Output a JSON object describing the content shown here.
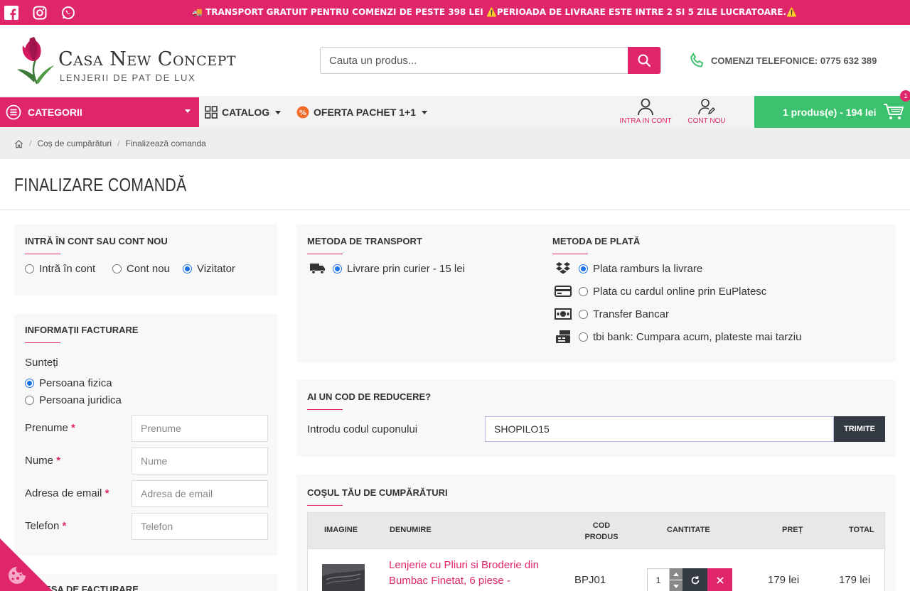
{
  "colors": {
    "brand": "#e0266b",
    "cart_green": "#3cc26e",
    "dark_button": "#333a44",
    "radio_selected": "#1a73e8"
  },
  "topbar": {
    "social_icons": [
      "facebook-icon",
      "instagram-icon",
      "whatsapp-icon"
    ],
    "promo": "🚚 TRANSPORT GRATUIT PENTRU COMENZI DE PESTE 398 LEI ⚠️PERIOADA DE LIVRARE ESTE INTRE 2 SI 5 ZILE LUCRATOARE.⚠️"
  },
  "header": {
    "brand": "Casa New Concept",
    "tagline": "LENJERII DE PAT DE LUX",
    "search_placeholder": "Cauta un produs...",
    "phone": "COMENZI TELEFONICE: 0775 632 389"
  },
  "nav": {
    "categories": "CATEGORII",
    "catalog": "CATALOG",
    "offer": "OFERTA PACHET 1+1",
    "login": "INTRA IN CONT",
    "register": "CONT NOU",
    "cart": "1 produs(e) - 194 lei",
    "cart_badge": "1"
  },
  "breadcrumb": [
    "Coș de cumpărături",
    "Finalizează comanda"
  ],
  "page_title": "FINALIZARE COMANDĂ",
  "account": {
    "title": "INTRĂ ÎN CONT SAU CONT NOU",
    "options": [
      "Intră în cont",
      "Cont nou",
      "Vizitator"
    ],
    "selected": "Vizitator"
  },
  "billing": {
    "title": "INFORMAȚII FACTURARE",
    "type_label": "Sunteți",
    "types": [
      "Persoana fizica",
      "Persoana juridica"
    ],
    "selected_type": "Persoana fizica",
    "fields": [
      {
        "label": "Prenume",
        "placeholder": "Prenume"
      },
      {
        "label": "Nume",
        "placeholder": "Nume"
      },
      {
        "label": "Adresa de email",
        "placeholder": "Adresa de email"
      },
      {
        "label": "Telefon",
        "placeholder": "Telefon"
      }
    ],
    "required_mark": "*",
    "next_section": "ADRESA DE FACTURARE"
  },
  "transport": {
    "title": "METODA DE TRANSPORT",
    "option": "Livrare prin curier - 15 lei"
  },
  "payment": {
    "title": "METODA DE PLATĂ",
    "options": [
      {
        "label": "Plata ramburs la livrare",
        "icon": "dropbox-icon"
      },
      {
        "label": "Plata cu cardul online prin EuPlatesc",
        "icon": "credit-card-icon"
      },
      {
        "label": "Transfer Bancar",
        "icon": "money-bill-icon"
      },
      {
        "label": "tbi bank: Cumpara acum, plateste mai tarziu",
        "icon": "cash-register-icon"
      }
    ],
    "selected": "Plata ramburs la livrare"
  },
  "coupon": {
    "title": "AI UN COD DE REDUCERE?",
    "label": "Introdu codul cuponului",
    "value": "SHOPILO15",
    "button": "TRIMITE"
  },
  "cart": {
    "title": "COȘUL TĂU DE CUMPĂRĂTURI",
    "headers": {
      "image": "IMAGINE",
      "name": "DENUMIRE",
      "code": "COD PRODUS",
      "qty": "CANTITATE",
      "price": "PREȚ",
      "total": "TOTAL"
    },
    "rows": [
      {
        "name": "Lenjerie cu Pliuri si Broderie din Bumbac Finetat, 6 piese - ",
        "code": "BPJ01",
        "qty": "1",
        "price": "179 lei",
        "total": "179 lei"
      }
    ]
  }
}
